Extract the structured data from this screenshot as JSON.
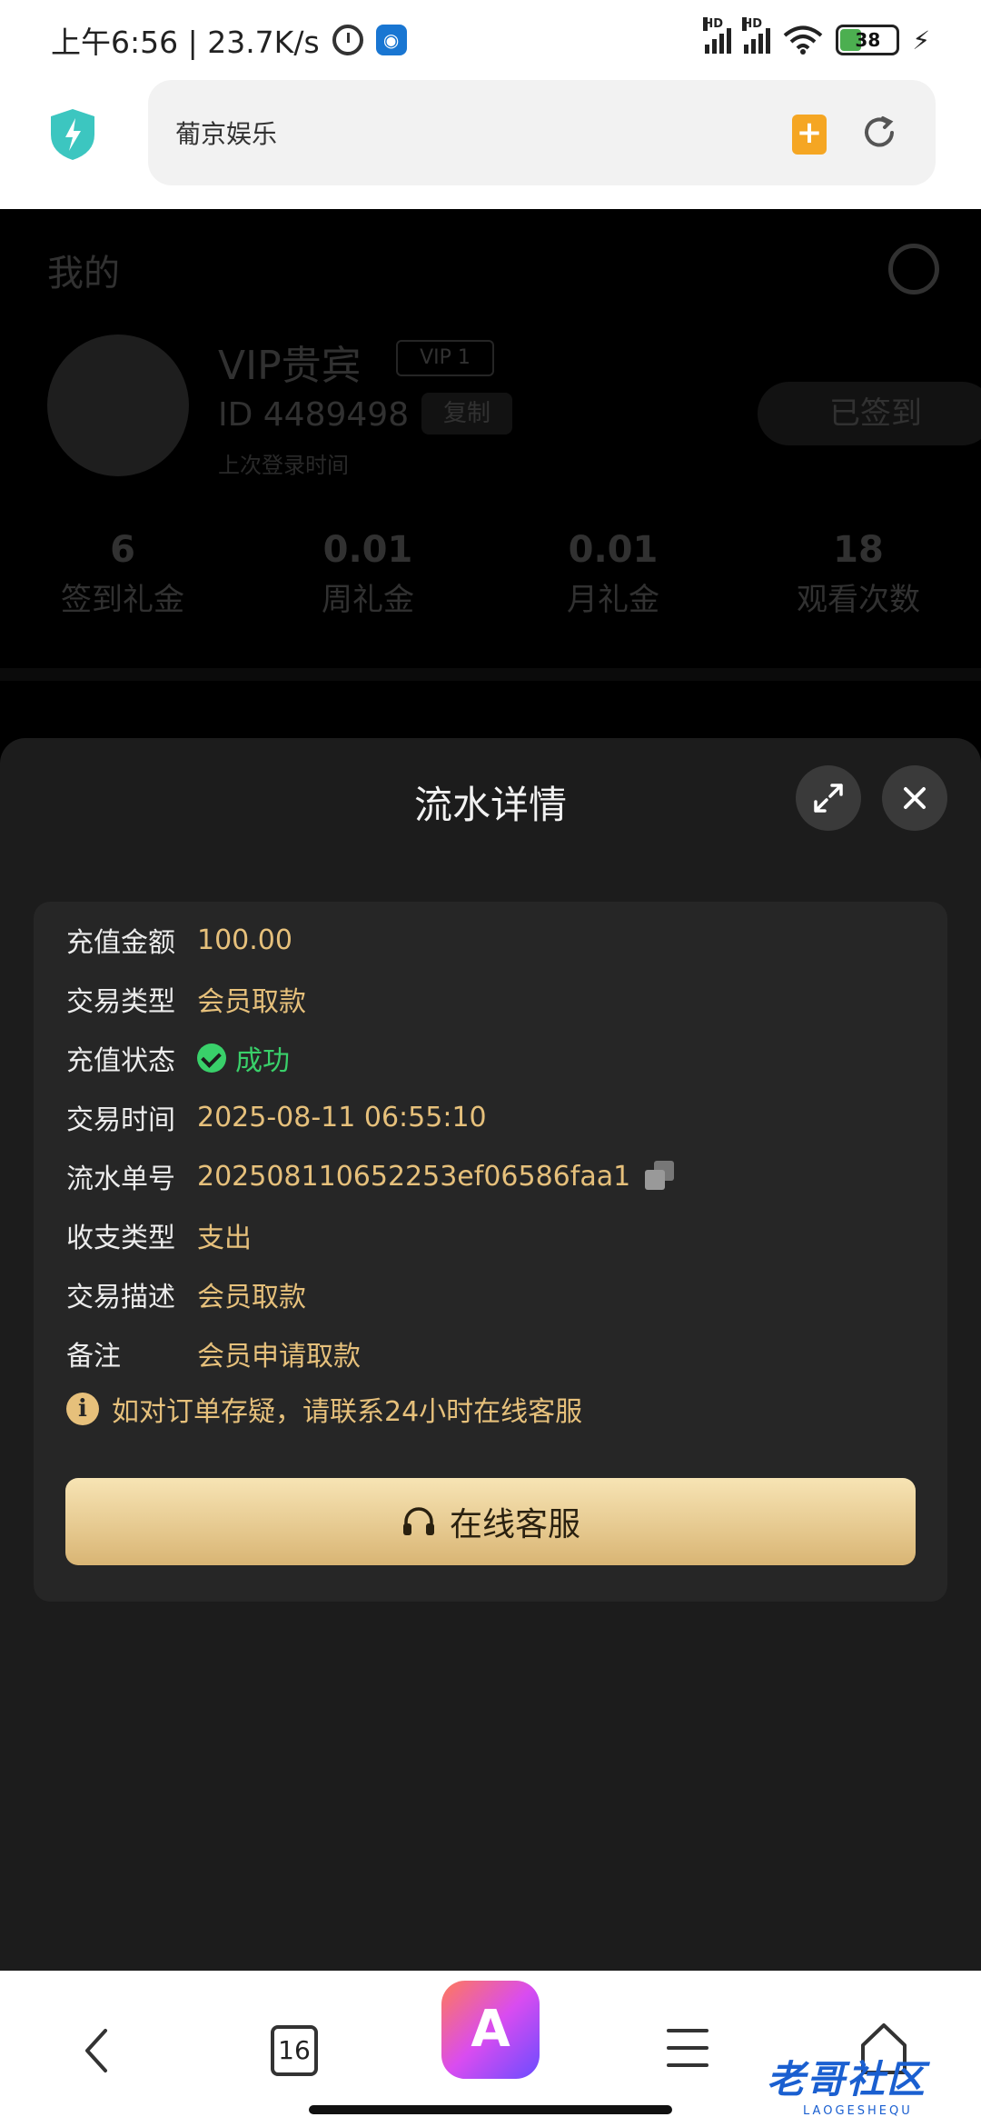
{
  "status_bar": {
    "time": "上午6:56 | 23.7K/s",
    "signal_label_1": "HD",
    "signal_label_2": "HD",
    "battery": "38",
    "charging_icon": "bolt-icon"
  },
  "browser": {
    "url": "葡京娱乐",
    "tab_count": "16",
    "ai_label": "A"
  },
  "background_page": {
    "title": "我的",
    "user_name": "VIP贵宾",
    "vip_badge": "VIP 1",
    "user_id": "ID 4489498",
    "copy_label": "复制",
    "last_login": "上次登录时间",
    "signed_label": "已签到",
    "stats": [
      {
        "value": "6",
        "label": "签到礼金"
      },
      {
        "value": "0.01",
        "label": "周礼金"
      },
      {
        "value": "0.01",
        "label": "月礼金"
      },
      {
        "value": "18",
        "label": "观看次数"
      }
    ]
  },
  "sheet": {
    "title": "流水详情",
    "rows": [
      {
        "label": "充值金额",
        "value": "100.00"
      },
      {
        "label": "交易类型",
        "value": "会员取款"
      },
      {
        "label": "充值状态",
        "value": "成功"
      },
      {
        "label": "交易时间",
        "value": "2025-08-11 06:55:10"
      },
      {
        "label": "流水单号",
        "value": "202508110652253ef06586faa1"
      },
      {
        "label": "收支类型",
        "value": "支出"
      },
      {
        "label": "交易描述",
        "value": "会员取款"
      },
      {
        "label": "备注",
        "value": "会员申请取款"
      }
    ],
    "notice": "如对订单存疑，请联系24小时在线客服",
    "cs_button": "在线客服"
  },
  "watermark": {
    "text": "老哥社区",
    "sub": "LAOGESHEQU"
  },
  "colors": {
    "accent_gold": "#e6c07b",
    "success_green": "#39d06a",
    "sheet_bg": "#1c1c1c"
  }
}
